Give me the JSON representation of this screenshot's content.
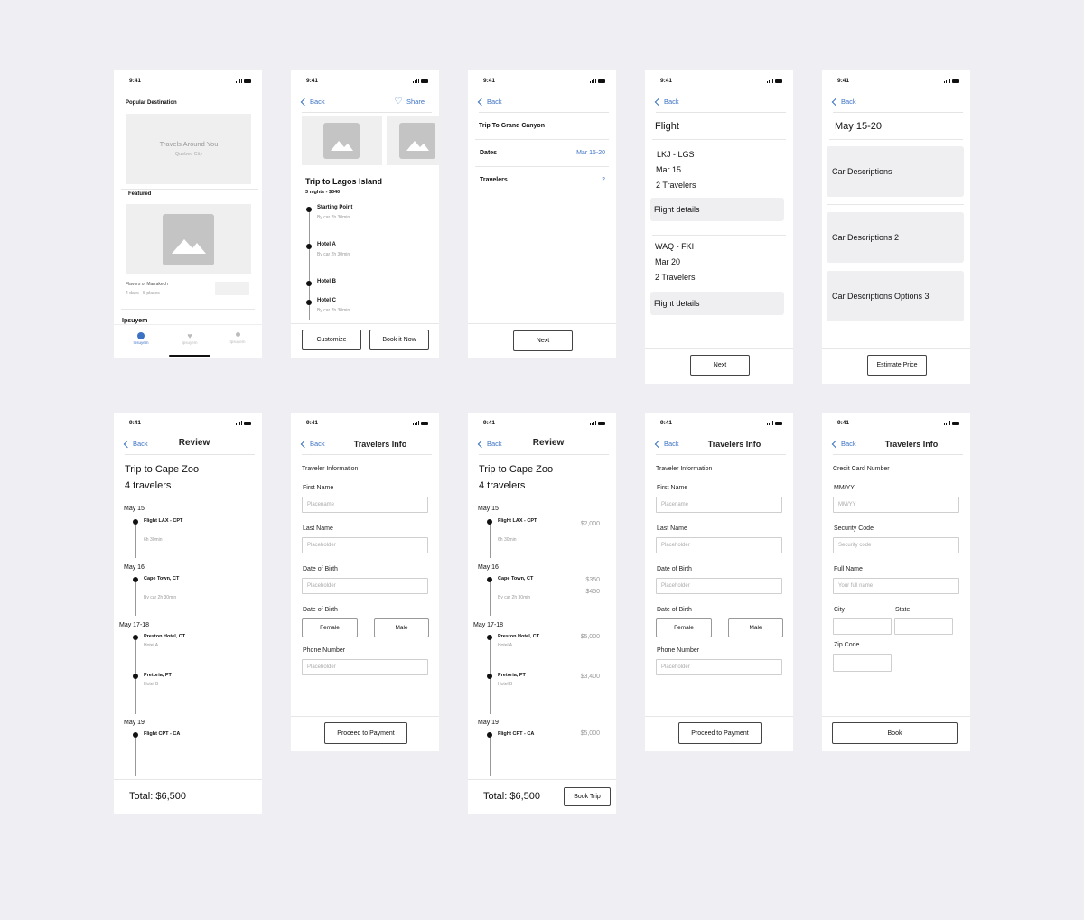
{
  "status_time": "9:41",
  "common": {
    "back": "Back",
    "placeholder": "Placeholder",
    "proceed": "Proceed to Payment",
    "female": "Female",
    "male": "Male",
    "traveler_information": "Traveler Information",
    "first_name": "First Name",
    "last_name": "Last Name",
    "dob": "Date of Birth",
    "phone": "Phone Number",
    "review": "Review",
    "travelers_info": "Travelers Info"
  },
  "s1": {
    "popular": "Popular Destination",
    "hero_title": "Travels Around You",
    "hero_sub": "Quebec City",
    "featured": "Featured",
    "card_title": "Flavors of Marrakech",
    "card_sub": "4 days · 5 places",
    "card_btn": "",
    "more": "Ipsuyem",
    "tabs": [
      "Ipsuyem",
      "Ipsuyem",
      "Ipsuyem"
    ]
  },
  "s2": {
    "share": "Share",
    "title": "Trip to Lagos Island",
    "sub": "3 nights - $340",
    "stops": [
      {
        "name": "Starting Point",
        "note": "By car 2h 30min"
      },
      {
        "name": "Hotel A",
        "note": "By car 2h 30min"
      },
      {
        "name": "Hotel B",
        "note": ""
      },
      {
        "name": "Hotel C",
        "note": "By car 2h 30min"
      }
    ],
    "customize": "Customize",
    "book": "Book it Now"
  },
  "s3": {
    "title": "Trip To Grand Canyon",
    "dates_label": "Dates",
    "dates_value": "Mar 15-20",
    "travelers_label": "Travelers",
    "travelers_value": "2",
    "next": "Next"
  },
  "s4": {
    "title": "Flight",
    "f1": {
      "route": "LKJ - LGS",
      "date": "Mar 15",
      "travelers": "2 Travelers",
      "details": "Flight details"
    },
    "f2": {
      "route": "WAQ - FKI",
      "date": "Mar 20",
      "travelers": "2 Travelers",
      "details": "Flight details"
    },
    "next": "Next"
  },
  "s5": {
    "title": "May 15-20",
    "cars": [
      "Car Descriptions",
      "Car Descriptions 2",
      "Car Descriptions Options 3"
    ],
    "estimate": "Estimate Price"
  },
  "review": {
    "trip": "Trip to Cape Zoo",
    "travelers": "4 travelers",
    "days": [
      {
        "label": "May 15",
        "items": [
          {
            "name": "Flight LAX - CPT",
            "note": "6h 30min",
            "price": "$2,000"
          }
        ]
      },
      {
        "label": "May 16",
        "items": [
          {
            "name": "Cape Town, CT",
            "note": "By car 2h 30min",
            "price": "$350",
            "price2": "$450"
          }
        ]
      },
      {
        "label": "May 17-18",
        "items": [
          {
            "name": "Preston Hotel, CT",
            "note": "Hotel A",
            "price": "$5,000"
          },
          {
            "name": "Pretoria, PT",
            "note": "Hotel B",
            "price": "$3,400"
          }
        ]
      },
      {
        "label": "May 19",
        "items": [
          {
            "name": "Flight CPT - CA",
            "note": "",
            "price": "$5,000"
          }
        ]
      }
    ],
    "total": "Total: $6,500",
    "book_trip": "Book Trip"
  },
  "s7": {
    "first_ph": "Placename"
  },
  "s10": {
    "cc": "Credit Card Number",
    "mmyy": "MM/YY",
    "mmyy_ph": "MM/YY",
    "sec": "Security Code",
    "sec_ph": "Security code",
    "full": "Full Name",
    "full_ph": "Your full name",
    "city": "City",
    "state": "State",
    "zip": "Zip Code",
    "book": "Book"
  }
}
